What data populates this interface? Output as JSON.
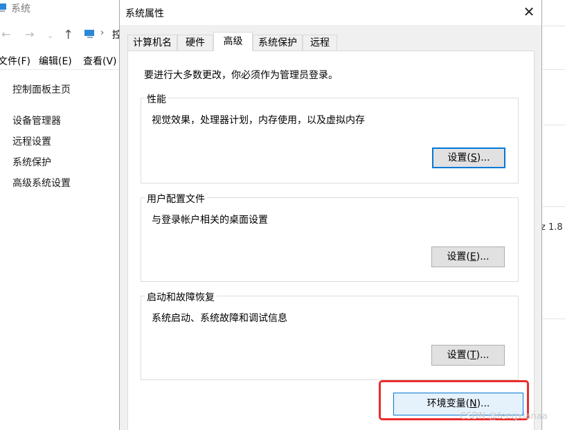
{
  "background_window": {
    "title": "系统",
    "address_text": "控",
    "menu": [
      "文件(F)",
      "编辑(E)",
      "查看(V)"
    ],
    "sidebar_links": [
      "控制面板主页",
      "设备管理器",
      "远程设置",
      "系统保护",
      "高级系统设置"
    ],
    "right_fragment": "z 1.8"
  },
  "dialog": {
    "title": "系统属性",
    "close_glyph": "✕",
    "tabs": [
      "计算机名",
      "硬件",
      "高级",
      "系统保护",
      "远程"
    ],
    "active_tab": "高级",
    "notice": "要进行大多数更改，你必须作为管理员登录。",
    "groups": [
      {
        "title": "性能",
        "description": "视觉效果，处理器计划，内存使用，以及虚拟内存",
        "button_label": "设置(",
        "button_key": "S",
        "button_suffix": ")..."
      },
      {
        "title": "用户配置文件",
        "description": "与登录帐户相关的桌面设置",
        "button_label": "设置(",
        "button_key": "E",
        "button_suffix": ")..."
      },
      {
        "title": "启动和故障恢复",
        "description": "系统启动、系统故障和调试信息",
        "button_label": "设置(",
        "button_key": "T",
        "button_suffix": ")..."
      }
    ],
    "env_button": {
      "label": "环境变量(",
      "key": "N",
      "suffix": ")..."
    }
  },
  "watermark": "CSDN @fengxianaa",
  "colors": {
    "highlight": "#ea2c2c",
    "focus_border": "#0078d7"
  }
}
